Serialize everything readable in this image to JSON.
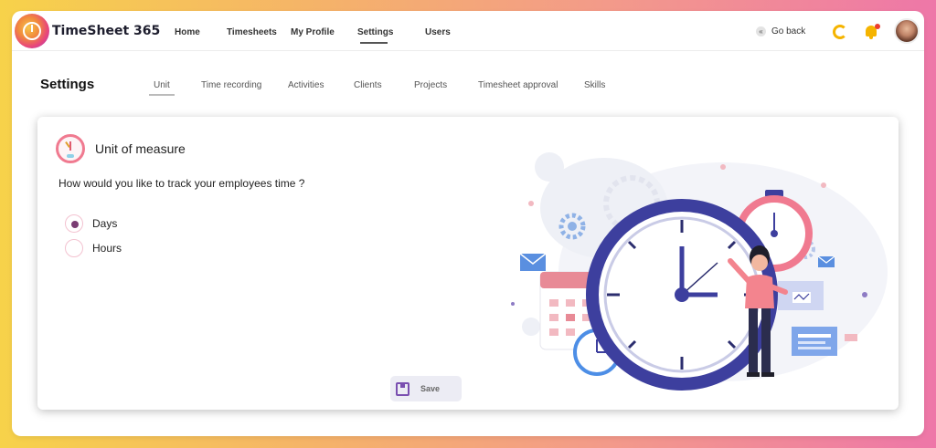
{
  "app": {
    "brand": "TimeSheet 365"
  },
  "nav": {
    "items": [
      {
        "label": "Home"
      },
      {
        "label": "Timesheets"
      },
      {
        "label": "My Profile"
      },
      {
        "label": "Settings"
      },
      {
        "label": "Users"
      }
    ],
    "go_back": "Go back"
  },
  "page": {
    "title": "Settings",
    "tabs": [
      {
        "label": "Unit"
      },
      {
        "label": "Time recording"
      },
      {
        "label": "Activities"
      },
      {
        "label": "Clients"
      },
      {
        "label": "Projects"
      },
      {
        "label": "Timesheet approval"
      },
      {
        "label": "Skills"
      }
    ],
    "active_tab": "Unit"
  },
  "card": {
    "title": "Unit of measure",
    "question": "How would you like to track your employees time ?",
    "options": [
      {
        "label": "Days",
        "checked": true
      },
      {
        "label": "Hours",
        "checked": false
      }
    ],
    "save_label": "Save"
  },
  "colors": {
    "accent": "#7a3d73",
    "clock": "#3d3f9e",
    "stopwatch": "#f07a90",
    "notification": "#ec3d2e"
  }
}
